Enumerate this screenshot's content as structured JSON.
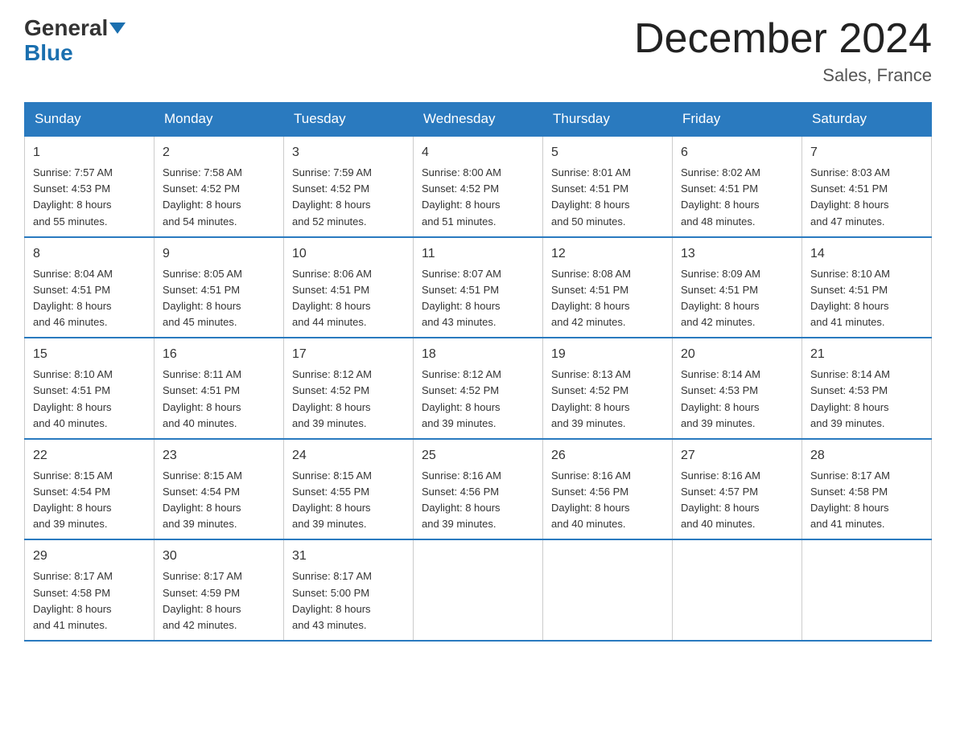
{
  "header": {
    "logo_general": "General",
    "logo_blue": "Blue",
    "month_title": "December 2024",
    "location": "Sales, France"
  },
  "days_of_week": [
    "Sunday",
    "Monday",
    "Tuesday",
    "Wednesday",
    "Thursday",
    "Friday",
    "Saturday"
  ],
  "weeks": [
    [
      {
        "day": "1",
        "info": "Sunrise: 7:57 AM\nSunset: 4:53 PM\nDaylight: 8 hours\nand 55 minutes."
      },
      {
        "day": "2",
        "info": "Sunrise: 7:58 AM\nSunset: 4:52 PM\nDaylight: 8 hours\nand 54 minutes."
      },
      {
        "day": "3",
        "info": "Sunrise: 7:59 AM\nSunset: 4:52 PM\nDaylight: 8 hours\nand 52 minutes."
      },
      {
        "day": "4",
        "info": "Sunrise: 8:00 AM\nSunset: 4:52 PM\nDaylight: 8 hours\nand 51 minutes."
      },
      {
        "day": "5",
        "info": "Sunrise: 8:01 AM\nSunset: 4:51 PM\nDaylight: 8 hours\nand 50 minutes."
      },
      {
        "day": "6",
        "info": "Sunrise: 8:02 AM\nSunset: 4:51 PM\nDaylight: 8 hours\nand 48 minutes."
      },
      {
        "day": "7",
        "info": "Sunrise: 8:03 AM\nSunset: 4:51 PM\nDaylight: 8 hours\nand 47 minutes."
      }
    ],
    [
      {
        "day": "8",
        "info": "Sunrise: 8:04 AM\nSunset: 4:51 PM\nDaylight: 8 hours\nand 46 minutes."
      },
      {
        "day": "9",
        "info": "Sunrise: 8:05 AM\nSunset: 4:51 PM\nDaylight: 8 hours\nand 45 minutes."
      },
      {
        "day": "10",
        "info": "Sunrise: 8:06 AM\nSunset: 4:51 PM\nDaylight: 8 hours\nand 44 minutes."
      },
      {
        "day": "11",
        "info": "Sunrise: 8:07 AM\nSunset: 4:51 PM\nDaylight: 8 hours\nand 43 minutes."
      },
      {
        "day": "12",
        "info": "Sunrise: 8:08 AM\nSunset: 4:51 PM\nDaylight: 8 hours\nand 42 minutes."
      },
      {
        "day": "13",
        "info": "Sunrise: 8:09 AM\nSunset: 4:51 PM\nDaylight: 8 hours\nand 42 minutes."
      },
      {
        "day": "14",
        "info": "Sunrise: 8:10 AM\nSunset: 4:51 PM\nDaylight: 8 hours\nand 41 minutes."
      }
    ],
    [
      {
        "day": "15",
        "info": "Sunrise: 8:10 AM\nSunset: 4:51 PM\nDaylight: 8 hours\nand 40 minutes."
      },
      {
        "day": "16",
        "info": "Sunrise: 8:11 AM\nSunset: 4:51 PM\nDaylight: 8 hours\nand 40 minutes."
      },
      {
        "day": "17",
        "info": "Sunrise: 8:12 AM\nSunset: 4:52 PM\nDaylight: 8 hours\nand 39 minutes."
      },
      {
        "day": "18",
        "info": "Sunrise: 8:12 AM\nSunset: 4:52 PM\nDaylight: 8 hours\nand 39 minutes."
      },
      {
        "day": "19",
        "info": "Sunrise: 8:13 AM\nSunset: 4:52 PM\nDaylight: 8 hours\nand 39 minutes."
      },
      {
        "day": "20",
        "info": "Sunrise: 8:14 AM\nSunset: 4:53 PM\nDaylight: 8 hours\nand 39 minutes."
      },
      {
        "day": "21",
        "info": "Sunrise: 8:14 AM\nSunset: 4:53 PM\nDaylight: 8 hours\nand 39 minutes."
      }
    ],
    [
      {
        "day": "22",
        "info": "Sunrise: 8:15 AM\nSunset: 4:54 PM\nDaylight: 8 hours\nand 39 minutes."
      },
      {
        "day": "23",
        "info": "Sunrise: 8:15 AM\nSunset: 4:54 PM\nDaylight: 8 hours\nand 39 minutes."
      },
      {
        "day": "24",
        "info": "Sunrise: 8:15 AM\nSunset: 4:55 PM\nDaylight: 8 hours\nand 39 minutes."
      },
      {
        "day": "25",
        "info": "Sunrise: 8:16 AM\nSunset: 4:56 PM\nDaylight: 8 hours\nand 39 minutes."
      },
      {
        "day": "26",
        "info": "Sunrise: 8:16 AM\nSunset: 4:56 PM\nDaylight: 8 hours\nand 40 minutes."
      },
      {
        "day": "27",
        "info": "Sunrise: 8:16 AM\nSunset: 4:57 PM\nDaylight: 8 hours\nand 40 minutes."
      },
      {
        "day": "28",
        "info": "Sunrise: 8:17 AM\nSunset: 4:58 PM\nDaylight: 8 hours\nand 41 minutes."
      }
    ],
    [
      {
        "day": "29",
        "info": "Sunrise: 8:17 AM\nSunset: 4:58 PM\nDaylight: 8 hours\nand 41 minutes."
      },
      {
        "day": "30",
        "info": "Sunrise: 8:17 AM\nSunset: 4:59 PM\nDaylight: 8 hours\nand 42 minutes."
      },
      {
        "day": "31",
        "info": "Sunrise: 8:17 AM\nSunset: 5:00 PM\nDaylight: 8 hours\nand 43 minutes."
      },
      {
        "day": "",
        "info": ""
      },
      {
        "day": "",
        "info": ""
      },
      {
        "day": "",
        "info": ""
      },
      {
        "day": "",
        "info": ""
      }
    ]
  ]
}
